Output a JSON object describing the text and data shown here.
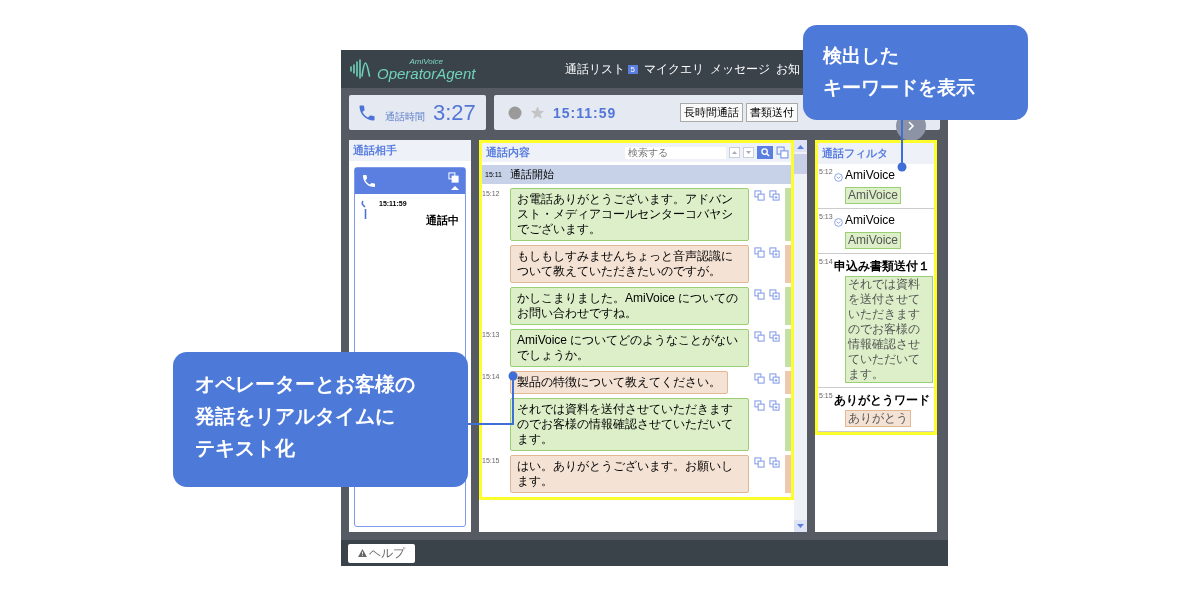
{
  "header": {
    "logo_small": "AmiVoice",
    "logo": "OperatorAgent",
    "nav": [
      {
        "label": "通話リスト",
        "badge": "5"
      },
      {
        "label": "マイクエリ"
      },
      {
        "label": "メッセージ"
      },
      {
        "label": "お知"
      }
    ]
  },
  "call_timer": {
    "label": "通話時間",
    "value": "3:27"
  },
  "call_info": {
    "time": "15:11:59",
    "buttons": [
      "長時間通話",
      "書類送付"
    ]
  },
  "contact_panel": {
    "title": "通話相手",
    "calls": [
      {
        "time": "15:11:59",
        "status": "通話中",
        "expanded": true
      }
    ]
  },
  "transcript": {
    "title": "通話内容",
    "search_placeholder": "検索する",
    "start": {
      "time": "15:11",
      "label": "通話開始"
    },
    "messages": [
      {
        "time": "15:12",
        "kind": "operator",
        "text": "お電話ありがとうございます。アドバンスト・メディアコールセンターコバヤシでございます。"
      },
      {
        "kind": "customer",
        "text": "もしもしすみませんちょっと音声認識について教えていただきたいのですが。"
      },
      {
        "kind": "operator",
        "text": "かしこまりました。AmiVoice についてのお問い合わせですね。"
      },
      {
        "time": "15:13",
        "kind": "operator",
        "text": "AmiVoice についてどのようなことがないでしょうか。"
      },
      {
        "time": "15:14",
        "kind": "customer",
        "text": "製品の特徴について教えてください。"
      },
      {
        "kind": "operator",
        "text": "それでは資料を送付させていただきますのでお客様の情報確認させていただいてます。"
      },
      {
        "time": "15:15",
        "kind": "customer",
        "text": "はい。ありがとうございます。お願いします。"
      }
    ]
  },
  "filter_panel": {
    "title": "通話フィルタ",
    "items": [
      {
        "time": "5:12",
        "collapsible": true,
        "name": "AmiVoice",
        "tag": "AmiVoice",
        "kind": "operator"
      },
      {
        "time": "5:13",
        "collapsible": true,
        "name": "AmiVoice",
        "tag": "AmiVoice",
        "kind": "operator"
      },
      {
        "time": "5:14",
        "collapsible": false,
        "name": "申込み書類送付１",
        "tag": "それでは資料を送付させていただきますのでお客様の情報確認させていただいてます。",
        "kind": "operator"
      },
      {
        "time": "5:15",
        "collapsible": false,
        "name": "ありがとうワード",
        "tag": "ありがとう",
        "kind": "customer"
      }
    ]
  },
  "footer": {
    "help": "ヘルプ"
  },
  "callouts": [
    {
      "kind": "top-right",
      "lines": [
        "検出した",
        "キーワードを表示"
      ]
    },
    {
      "kind": "left",
      "lines": [
        "オペレーターとお客様の",
        "発話をリアルタイムに",
        "テキスト化"
      ]
    }
  ]
}
